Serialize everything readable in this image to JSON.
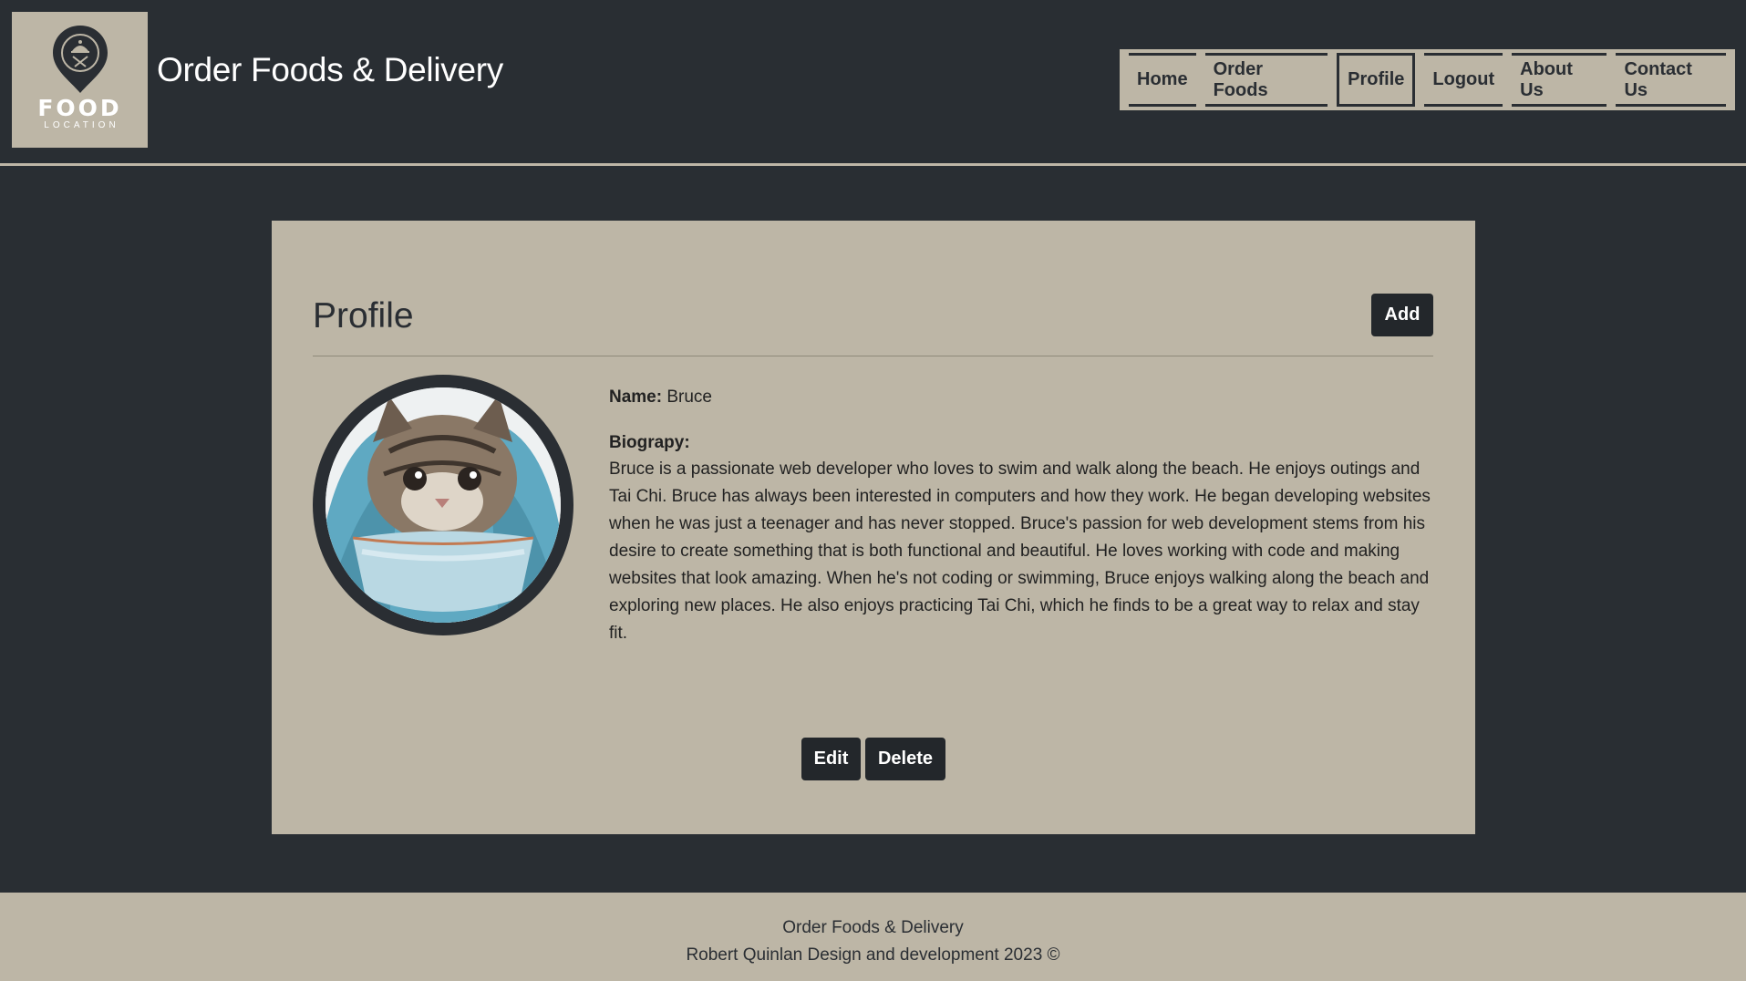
{
  "header": {
    "logo_word": "FOOD",
    "logo_sub": "LOCATION",
    "site_title": "Order Foods & Delivery",
    "nav": [
      "Home",
      "Order Foods",
      "Profile",
      "Logout",
      "About Us",
      "Contact Us"
    ],
    "active_nav": "Profile"
  },
  "profile": {
    "title": "Profile",
    "add_label": "Add",
    "name_label": "Name:",
    "name_value": "Bruce",
    "bio_label": "Biograpy:",
    "bio_text": "Bruce is a passionate web developer who loves to swim and walk along the beach. He enjoys outings and Tai Chi. Bruce has always been interested in computers and how they work. He began developing websites when he was just a teenager and has never stopped. Bruce's passion for web development stems from his desire to create something that is both functional and beautiful. He loves working with code and making websites that look amazing. When he's not coding or swimming, Bruce enjoys walking along the beach and exploring new places. He also enjoys practicing Tai Chi, which he finds to be a great way to relax and stay fit.",
    "edit_label": "Edit",
    "delete_label": "Delete",
    "avatar_icon": "kitten-in-bowl-image"
  },
  "footer": {
    "line1": "Order Foods & Delivery",
    "line2": "Robert Quinlan Design and development 2023 ©"
  },
  "colors": {
    "background": "#292e33",
    "panel": "#bdb6a6",
    "button": "#23272b",
    "text_light": "#ffffff"
  }
}
